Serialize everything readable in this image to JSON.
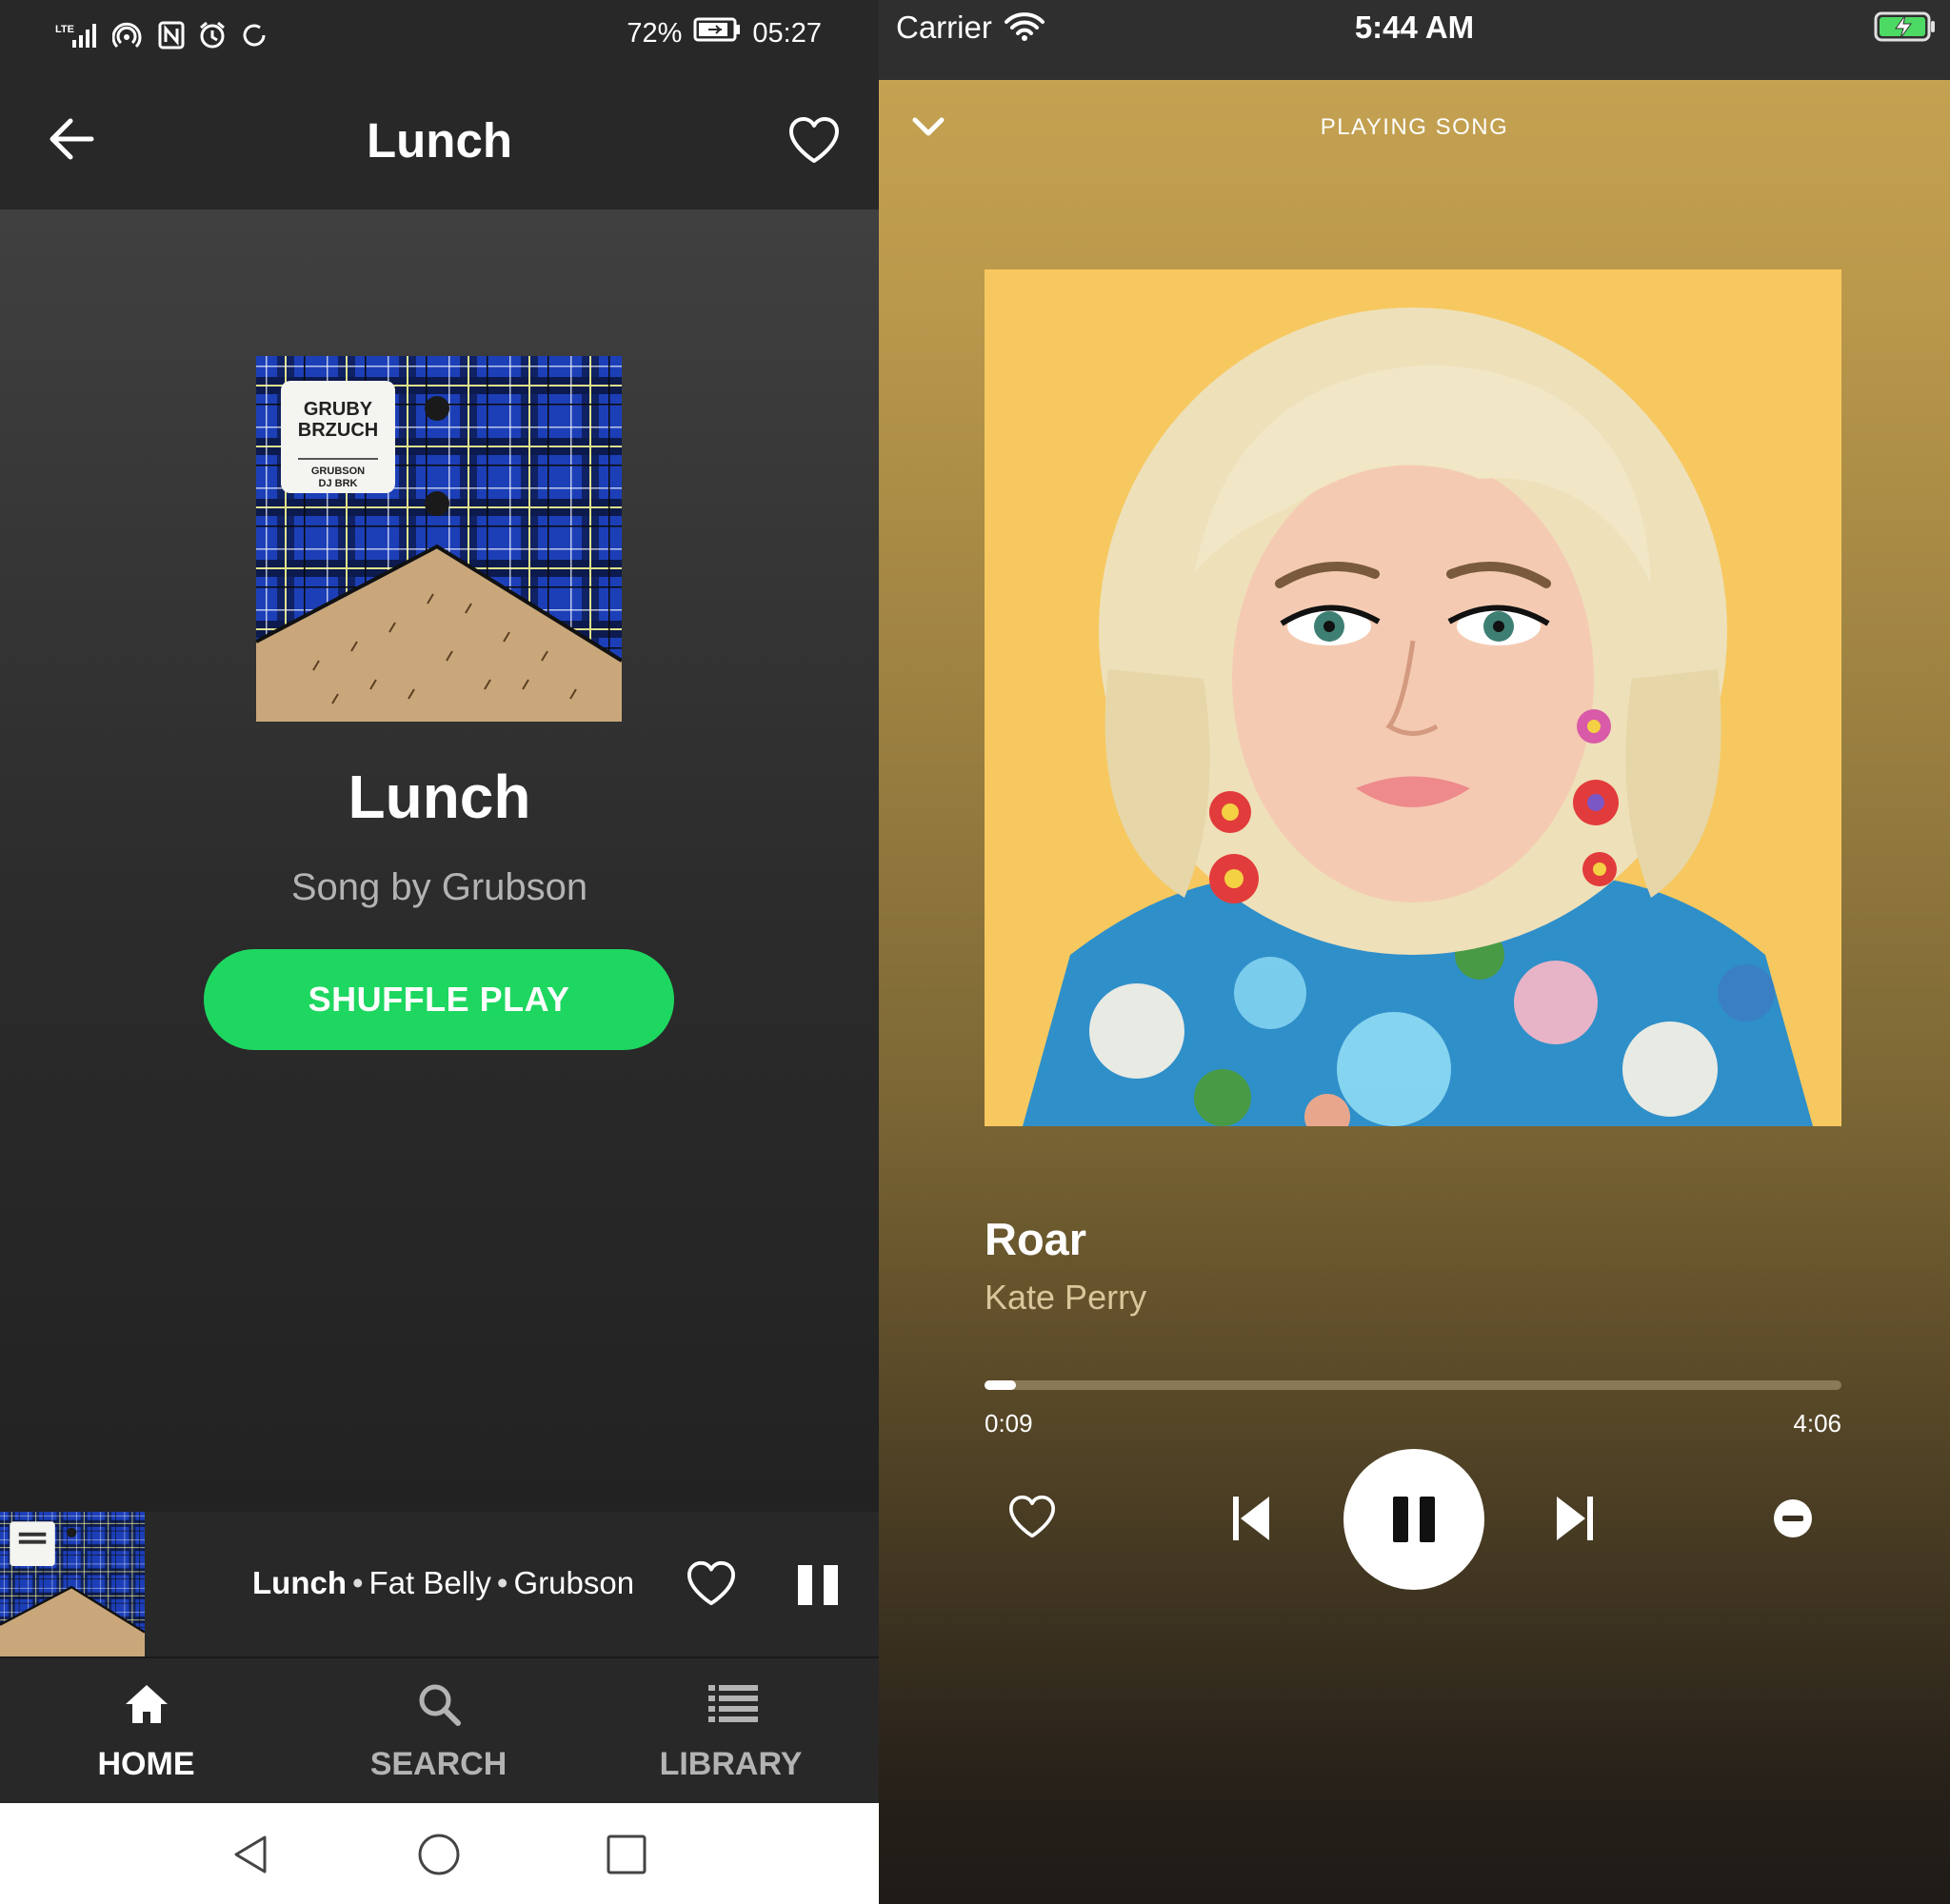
{
  "android": {
    "status_bar": {
      "network": "LTE",
      "battery": "72%",
      "time": "05:27"
    },
    "header": {
      "title": "Lunch"
    },
    "album_cover": {
      "logo_text": "GRUBY BRZUCH",
      "credits_text": "GRUBSON DJ BRK"
    },
    "song": {
      "title": "Lunch",
      "subtitle": "Song by Grubson"
    },
    "shuffle_button": "SHUFFLE PLAY",
    "mini_player": {
      "title": "Lunch",
      "album": "Fat Belly",
      "artist": "Grubson",
      "separator": "•"
    },
    "bottom_nav": [
      {
        "label": "HOME",
        "icon": "home-icon",
        "active": true
      },
      {
        "label": "SEARCH",
        "icon": "search-icon",
        "active": false
      },
      {
        "label": "LIBRARY",
        "icon": "library-icon",
        "active": false
      }
    ],
    "colors": {
      "accent": "#1ed760",
      "background": "#212121",
      "bar": "#282828"
    }
  },
  "ios": {
    "status_bar": {
      "carrier": "Carrier",
      "time": "5:44 AM"
    },
    "header_label": "PLAYING SONG",
    "song": {
      "title": "Roar",
      "artist": "Kate Perry"
    },
    "progress": {
      "elapsed": "0:09",
      "total": "4:06",
      "fraction": 0.037
    },
    "controls": [
      "heart-icon",
      "previous-icon",
      "pause-icon",
      "next-icon",
      "remove-icon"
    ],
    "colors": {
      "gradient_top": "#c8a554",
      "gradient_bottom": "#1e1b18"
    }
  }
}
